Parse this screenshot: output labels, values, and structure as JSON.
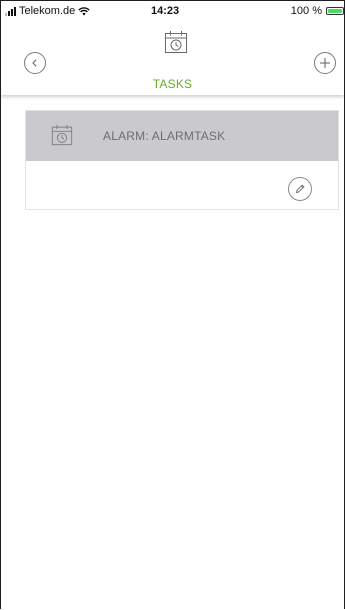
{
  "status_bar": {
    "carrier": "Telekom.de",
    "time": "14:23",
    "battery": "100 %",
    "battery_level": 1.0,
    "icons": [
      "signal-icon",
      "wifi-icon",
      "battery-icon"
    ]
  },
  "header": {
    "title": "TASKS",
    "title_color": "#64b024",
    "icons": {
      "back": "chevron-left-icon",
      "main": "calendar-clock-icon",
      "add": "plus-icon"
    }
  },
  "tasks": [
    {
      "label": "ALARM: ALARMTASK",
      "icon": "calendar-clock-icon",
      "action_icon": "pencil-icon"
    }
  ],
  "colors": {
    "accent": "#64b024",
    "task_header_bg": "#cacace",
    "task_title": "#6e6e6e"
  }
}
